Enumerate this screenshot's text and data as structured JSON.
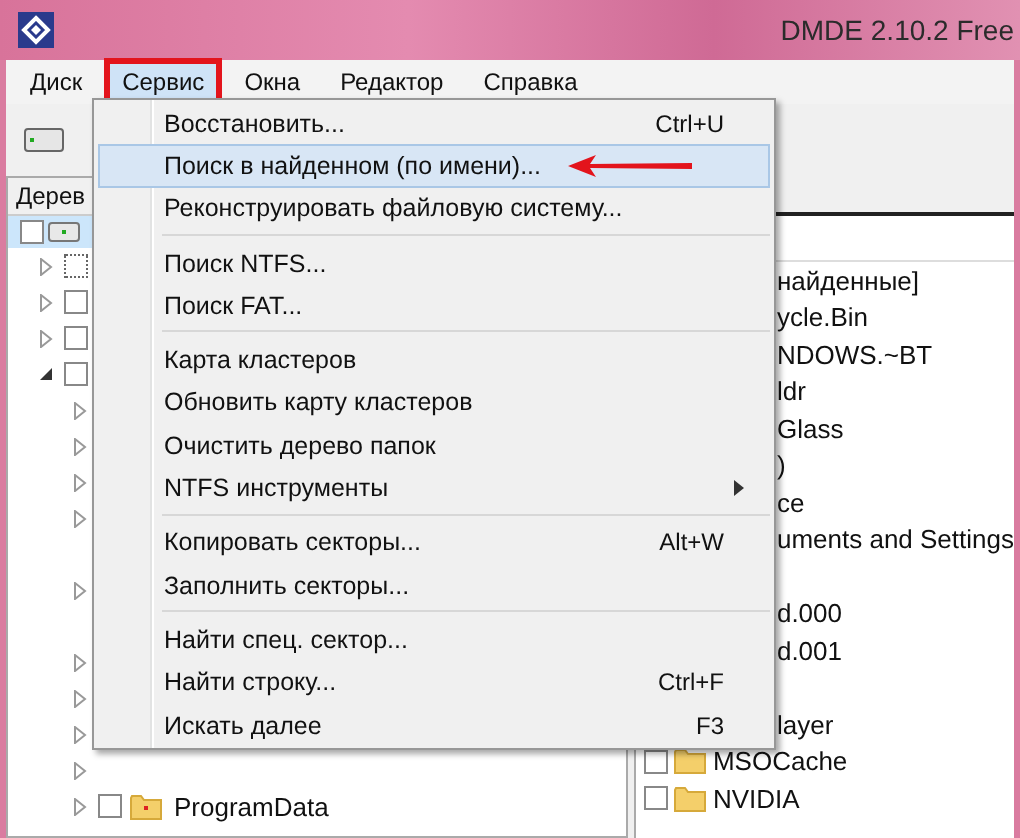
{
  "window": {
    "title": "DMDE 2.10.2 Free"
  },
  "menubar": [
    {
      "label": "Диск",
      "selected": false
    },
    {
      "label": "Сервис",
      "selected": true
    },
    {
      "label": "Окна",
      "selected": false
    },
    {
      "label": "Редактор",
      "selected": false
    },
    {
      "label": "Справка",
      "selected": false
    }
  ],
  "tree": {
    "header": "Дерев",
    "root": {
      "selected": true,
      "checked": false,
      "children": [
        {
          "kind": "dotted",
          "expanded": false,
          "checked": false
        },
        {
          "kind": "box",
          "expanded": false,
          "checked": false
        },
        {
          "kind": "box",
          "expanded": false,
          "checked": false
        },
        {
          "kind": "box",
          "expanded": true,
          "checked": false,
          "children": [
            {
              "expandable": true
            },
            {
              "expandable": true
            },
            {
              "expandable": true
            },
            {
              "expandable": true
            },
            {
              "expandable": false
            },
            {
              "expandable": true
            },
            {
              "expandable": false
            },
            {
              "expandable": true
            },
            {
              "expandable": true
            },
            {
              "expandable": true
            },
            {
              "expandable": true
            },
            {
              "expandable": true,
              "label": "ProgramData",
              "checked": false
            }
          ]
        }
      ]
    }
  },
  "list": {
    "rows": [
      {
        "text": "найденные]",
        "covered": true
      },
      {
        "text": "ycle.Bin",
        "covered": true
      },
      {
        "text": "NDOWS.~BT",
        "covered": true
      },
      {
        "text": "ldr",
        "covered": true
      },
      {
        "text": "Glass",
        "covered": true
      },
      {
        "text": ")",
        "covered": true
      },
      {
        "text": "ce",
        "covered": true
      },
      {
        "text": "uments and Settings",
        "covered": true
      },
      {
        "covered": true
      },
      {
        "text": "d.000",
        "covered": true
      },
      {
        "text": "d.001",
        "covered": true
      },
      {
        "covered": true
      },
      {
        "text": "layer",
        "covered": true
      },
      {
        "text": "MSOCache",
        "covered": false,
        "checked": false
      },
      {
        "text": "NVIDIA",
        "covered": false,
        "checked": false
      }
    ]
  },
  "menu": [
    {
      "kind": "item",
      "label": "Восстановить...",
      "shortcut": "Ctrl+U",
      "selected": false
    },
    {
      "kind": "item",
      "label": "Поиск в найденном (по имени)...",
      "selected": true,
      "marked": true
    },
    {
      "kind": "item",
      "label": "Реконструировать файловую систему...",
      "selected": false
    },
    {
      "kind": "separator"
    },
    {
      "kind": "item",
      "label": "Поиск NTFS...",
      "selected": false
    },
    {
      "kind": "item",
      "label": "Поиск FAT...",
      "selected": false
    },
    {
      "kind": "separator"
    },
    {
      "kind": "item",
      "label": "Карта кластеров",
      "selected": false
    },
    {
      "kind": "item",
      "label": "Обновить карту кластеров",
      "selected": false
    },
    {
      "kind": "item",
      "label": "Очистить дерево папок",
      "selected": false
    },
    {
      "kind": "item",
      "label": "NTFS инструменты",
      "selected": false,
      "submenu": true
    },
    {
      "kind": "separator"
    },
    {
      "kind": "item",
      "label": "Копировать секторы...",
      "shortcut": "Alt+W",
      "selected": false
    },
    {
      "kind": "item",
      "label": "Заполнить секторы...",
      "selected": false
    },
    {
      "kind": "separator"
    },
    {
      "kind": "item",
      "label": "Найти спец. сектор...",
      "selected": false
    },
    {
      "kind": "item",
      "label": "Найти строку...",
      "shortcut": "Ctrl+F",
      "selected": false
    },
    {
      "kind": "item",
      "label": "Искать далее",
      "shortcut": "F3",
      "selected": false
    }
  ]
}
